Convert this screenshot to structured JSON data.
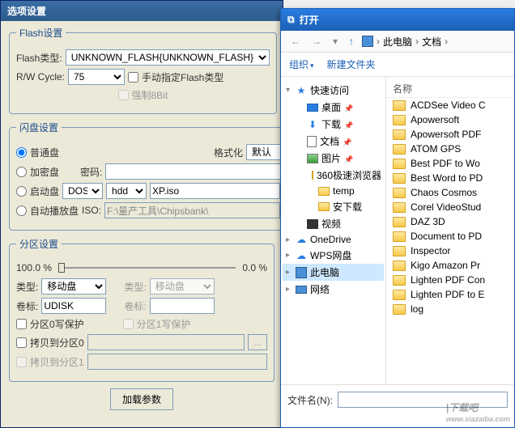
{
  "options": {
    "title": "选项设置",
    "flash_group": "Flash设置",
    "flash_type_label": "Flash类型:",
    "flash_type_value": "UNKNOWN_FLASH{UNKNOWN_FLASH}",
    "rw_cycle_label": "R/W Cycle:",
    "rw_cycle_value": "75",
    "manual_flash_label": "手动指定Flash类型",
    "force8bit_label": "强制8Bit",
    "disk_group": "闪盘设置",
    "normal_disk": "普通盘",
    "format_label": "格式化",
    "format_value": "默认",
    "encrypt_disk": "加密盘",
    "password_label": "密码:",
    "boot_disk": "启动盘",
    "boot_os": "DOS",
    "boot_media": "hdd",
    "boot_iso": "XP.iso",
    "autoplay_disk": "自动播放盘",
    "iso_label": "ISO:",
    "iso_path": "F:\\量产工具\\Chipsbank\\",
    "partition_group": "分区设置",
    "slider_left": "100.0 %",
    "slider_right": "0.0 %",
    "type_label": "类型:",
    "type_left": "移动盘",
    "type_right": "移动盘",
    "volume_label": "卷标:",
    "volume_left": "UDISK",
    "volume_right": "",
    "wp0": "分区0写保护",
    "wp1": "分区1写保护",
    "cp0": "拷贝到分区0",
    "cp1": "拷贝到分区1",
    "load_btn": "加载参数"
  },
  "open": {
    "title": "打开",
    "path_root": "此电脑",
    "path_current": "文档",
    "organize": "组织",
    "new_folder": "新建文件夹",
    "filename_label": "文件名(N):",
    "filename_value": "",
    "col_name": "名称",
    "tree": [
      {
        "icon": "star",
        "label": "快速访问",
        "caret": "expanded"
      },
      {
        "icon": "desktop",
        "label": "桌面",
        "indent": 1,
        "pin": true
      },
      {
        "icon": "down",
        "label": "下载",
        "indent": 1,
        "pin": true
      },
      {
        "icon": "doc",
        "label": "文档",
        "indent": 1,
        "pin": true
      },
      {
        "icon": "pic",
        "label": "图片",
        "indent": 1,
        "pin": true
      },
      {
        "icon": "folder",
        "label": "360极速浏览器",
        "indent": 2
      },
      {
        "icon": "folder",
        "label": "temp",
        "indent": 2
      },
      {
        "icon": "folder",
        "label": "安下载",
        "indent": 2
      },
      {
        "icon": "vid",
        "label": "视频",
        "indent": 1
      },
      {
        "icon": "cloud",
        "label": "OneDrive",
        "caret": "collapsed"
      },
      {
        "icon": "cloud",
        "label": "WPS网盘",
        "caret": "collapsed"
      },
      {
        "icon": "pc",
        "label": "此电脑",
        "caret": "collapsed",
        "selected": true
      },
      {
        "icon": "net",
        "label": "网络",
        "caret": "collapsed"
      }
    ],
    "files": [
      "ACDSee Video C",
      "Apowersoft",
      "Apowersoft PDF",
      "ATOM GPS",
      "Best PDF to Wo",
      "Best Word to PD",
      "Chaos Cosmos",
      "Corel VideoStud",
      "DAZ 3D",
      "Document to PD",
      "Inspector",
      "Kigo Amazon Pr",
      "Lighten PDF Con",
      "Lighten PDF to E",
      "log"
    ]
  },
  "watermark": {
    "main": "|下载吧",
    "sub": "www.xiazaiba.com"
  }
}
